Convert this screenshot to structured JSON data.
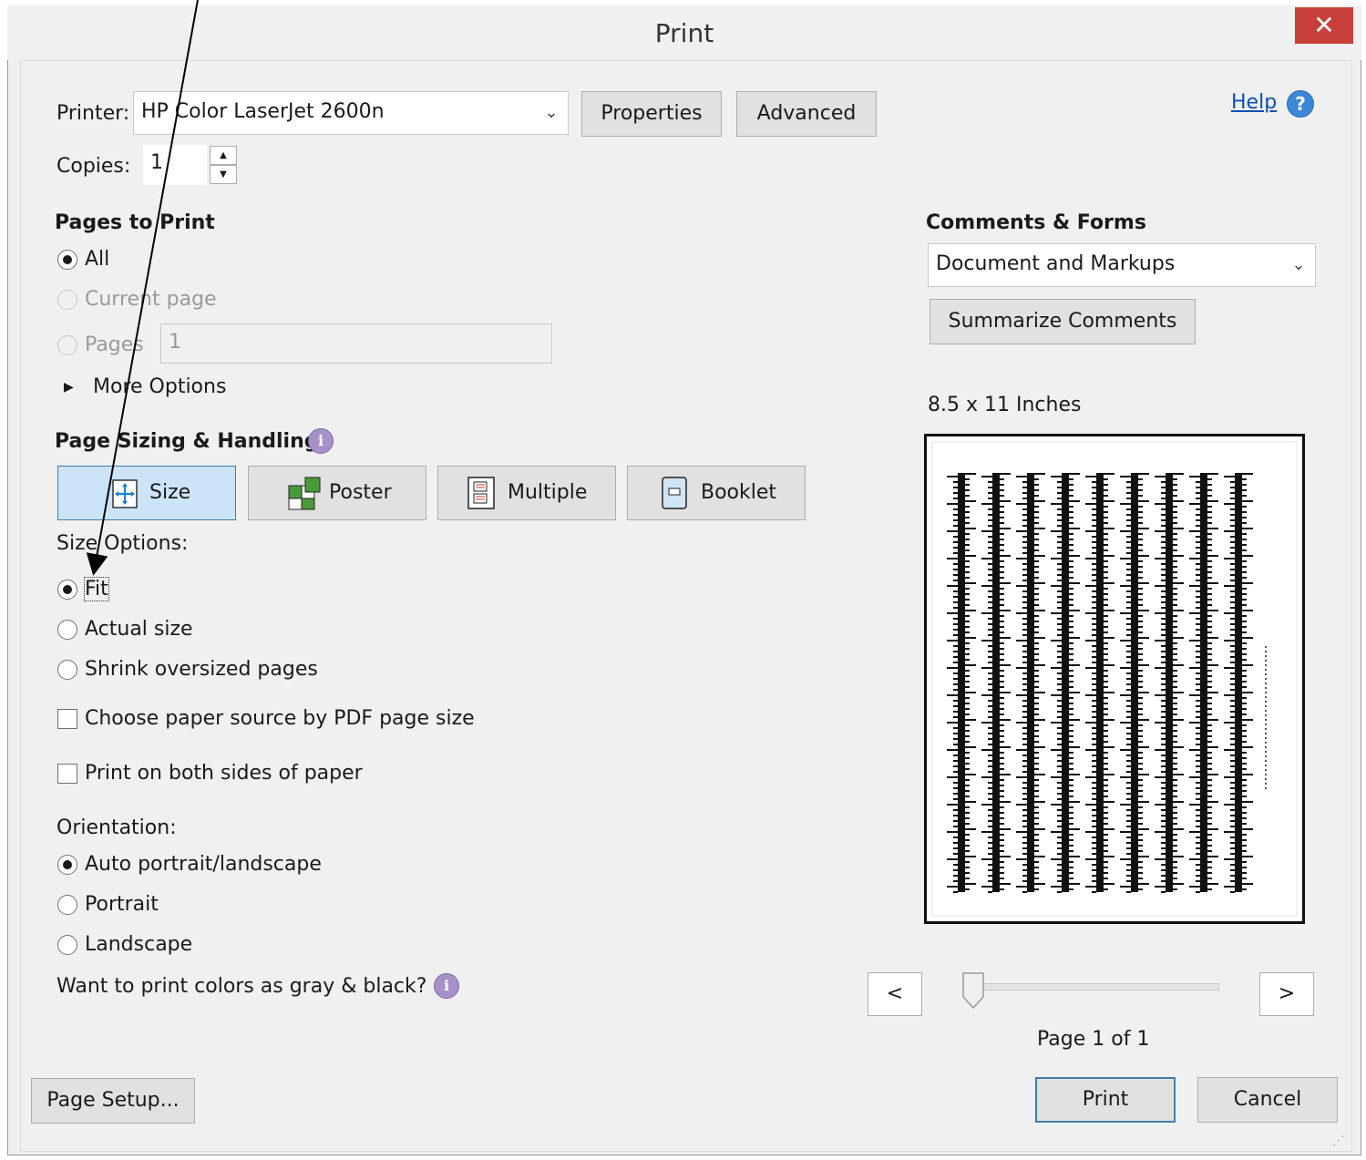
{
  "window": {
    "title": "Print",
    "close_glyph": "✕"
  },
  "help": {
    "label": "Help",
    "icon": "help-icon"
  },
  "printer": {
    "label": "Printer:",
    "value": "HP Color LaserJet 2600n",
    "properties_label": "Properties",
    "advanced_label": "Advanced"
  },
  "copies": {
    "label": "Copies:",
    "value": "1"
  },
  "pages_to_print": {
    "heading": "Pages to Print",
    "all_label": "All",
    "current_label": "Current page",
    "pages_label": "Pages",
    "pages_value": "1",
    "more_options_label": "More Options"
  },
  "sizing": {
    "heading": "Page Sizing & Handling",
    "tabs": [
      "Size",
      "Poster",
      "Multiple",
      "Booklet"
    ],
    "size_options_label": "Size Options:",
    "fit_label": "Fit",
    "actual_label": "Actual size",
    "shrink_label": "Shrink oversized pages",
    "paper_source_label": "Choose paper source by PDF page size",
    "both_sides_label": "Print on both sides of paper"
  },
  "orientation": {
    "label": "Orientation:",
    "auto_label": "Auto portrait/landscape",
    "portrait_label": "Portrait",
    "landscape_label": "Landscape"
  },
  "gray_label": "Want to print colors as gray & black?",
  "comments": {
    "heading": "Comments & Forms",
    "value": "Document and Markups",
    "summarize_label": "Summarize Comments"
  },
  "preview": {
    "size_label": "8.5 x 11 Inches",
    "page_label": "Page 1 of 1",
    "prev": "<",
    "next": ">",
    "page": 1,
    "page_count": 1
  },
  "footer": {
    "page_setup_label": "Page Setup...",
    "print_label": "Print",
    "cancel_label": "Cancel"
  }
}
